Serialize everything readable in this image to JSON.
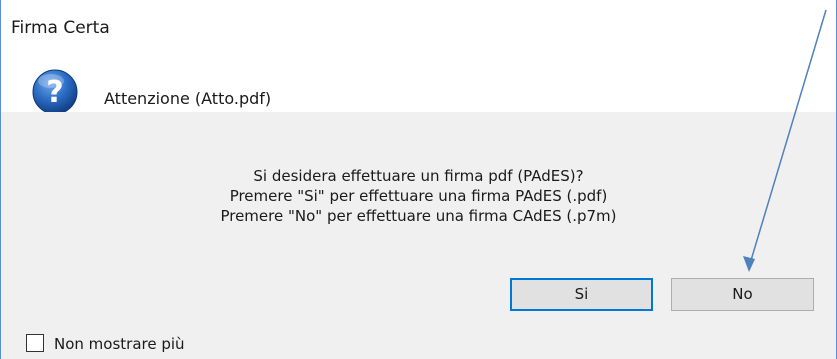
{
  "dialog": {
    "title": "Firma Certa",
    "header": "Attenzione (Atto.pdf)",
    "icon": "question-icon",
    "message_lines": [
      "Si desidera effettuare un firma pdf (PAdES)?",
      "Premere \"Si\" per effettuare una firma PAdES (.pdf)",
      "Premere \"No\" per effettuare una firma CAdES (.p7m)"
    ],
    "buttons": {
      "yes_label": "Si",
      "no_label": "No"
    },
    "checkbox": {
      "label": "Non mostrare più",
      "checked": false
    }
  },
  "colors": {
    "accent": "#0078d7",
    "border": "#5a8fd6",
    "arrow": "#4f81bd",
    "icon_blue": "#1f5fae"
  }
}
